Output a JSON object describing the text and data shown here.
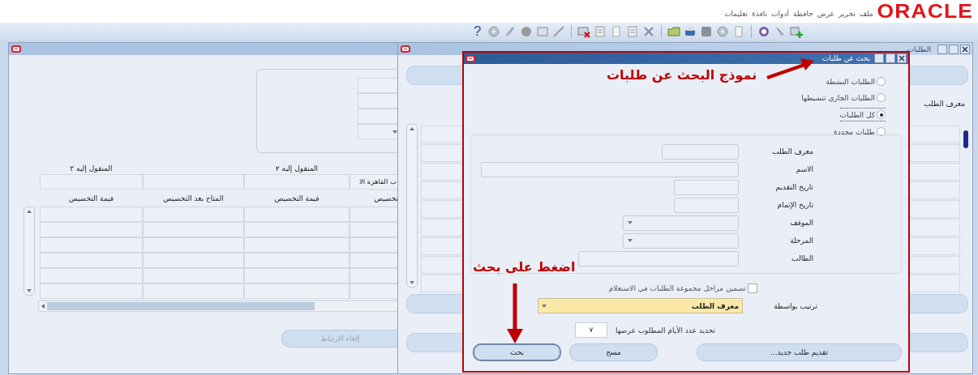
{
  "logo": "ORACLE",
  "menu": [
    "ملف",
    "تحرير",
    "عرض",
    "حافظة",
    "أدوات",
    "نافذة",
    "تعليمات"
  ],
  "toolbar": {
    "help": "?"
  },
  "left_window": {
    "transfer_headers": [
      "المنقول إليه ٢",
      "المنقول إليه ٣"
    ],
    "transfer_value": "ب القاهرة الا",
    "table": {
      "columns": [
        "تخصيص",
        "قيمة التخصيص",
        "المتاح بعد التخصيص",
        "قيمة التخصيص"
      ]
    },
    "button": {
      "label": "إلغاء الارتباط",
      "disabled": true
    }
  },
  "middle_window": {
    "title": "الطلبات",
    "label": "معرف الطلب"
  },
  "dialog": {
    "title": "بحث عن طلبات",
    "radios": [
      {
        "label": "الطلبات النشطة",
        "selected": false
      },
      {
        "label": "الطلبات الجاري تنشيطها",
        "selected": false
      },
      {
        "label": "كل الطلبات",
        "selected": true
      },
      {
        "label": "طلبات محددة",
        "selected": false
      }
    ],
    "fields": [
      {
        "label": "معرف الطلب",
        "kind": "text"
      },
      {
        "label": "الاسم",
        "kind": "text"
      },
      {
        "label": "تاريخ التقديم",
        "kind": "text"
      },
      {
        "label": "تاريخ الإتمام",
        "kind": "text"
      },
      {
        "label": "الموقف",
        "kind": "select"
      },
      {
        "label": "المرحلة",
        "kind": "select"
      },
      {
        "label": "الطالب",
        "kind": "text"
      }
    ],
    "include_phases": {
      "label": "تضمين مراحل مجموعة الطلبات في الاستعلام",
      "checked": false
    },
    "sort_by": {
      "label": "ترتيب بواسطة",
      "value": "معرف الطلب"
    },
    "days": {
      "label": "تحديد عدد الأيام المطلوب عرضها",
      "value": "٧"
    },
    "buttons": [
      {
        "label": "تقديم طلب جديد...",
        "default": false
      },
      {
        "label": "مسح",
        "default": false
      },
      {
        "label": "بحث",
        "default": true
      }
    ]
  },
  "annotations": [
    {
      "text": "نموذج البحث عن طلبات"
    },
    {
      "text": "اضغط على بحث"
    }
  ]
}
